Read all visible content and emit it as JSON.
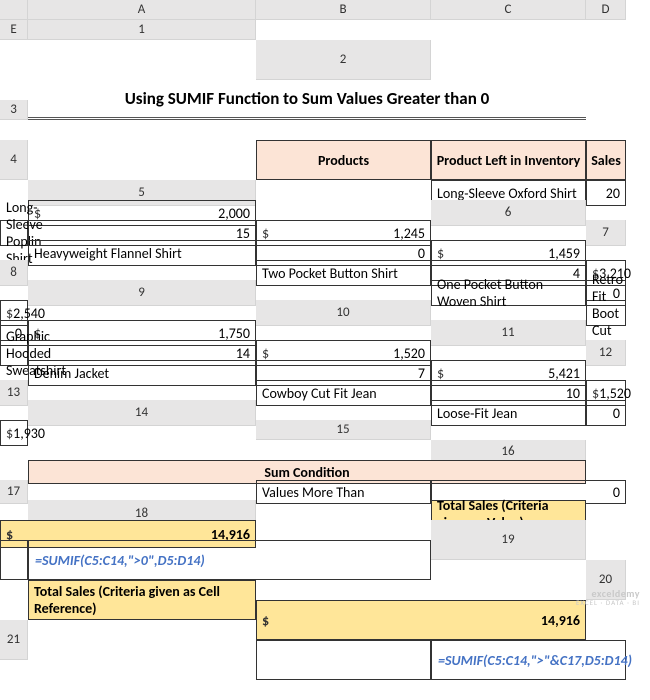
{
  "cols": [
    "",
    "A",
    "B",
    "C",
    "D",
    "E"
  ],
  "title": "Using SUMIF Function to Sum Values Greater than 0",
  "table": {
    "headers": [
      "Products",
      "Product Left in Inventory",
      "Sales"
    ],
    "rows": [
      {
        "p": "Long-Sleeve Oxford Shirt",
        "inv": "20",
        "sales": "2,000"
      },
      {
        "p": "Long-Sleeve Poplin Shirt",
        "inv": "15",
        "sales": "1,245"
      },
      {
        "p": "Heavyweight Flannel Shirt",
        "inv": "0",
        "sales": "1,459"
      },
      {
        "p": "Two Pocket Button Shirt",
        "inv": "4",
        "sales": "3,210"
      },
      {
        "p": "One Pocket Button Woven Shirt",
        "inv": "0",
        "sales": "2,540"
      },
      {
        "p": "Retro Fit Boot Cut Jean",
        "inv": "0",
        "sales": "1,750"
      },
      {
        "p": "Graphic Hooded Sweatshirt",
        "inv": "14",
        "sales": "1,520"
      },
      {
        "p": "Denim Jacket",
        "inv": "7",
        "sales": "5,421"
      },
      {
        "p": "Cowboy Cut Fit Jean",
        "inv": "10",
        "sales": "1,520"
      },
      {
        "p": "Loose-Fit Jean",
        "inv": "0",
        "sales": "1,930"
      }
    ]
  },
  "sum": {
    "header": "Sum Condition",
    "r1_label": "Values More Than",
    "r1_val": "0",
    "r2_label": "Total Sales (Criteria given as Value)",
    "r2_val": "14,916",
    "f1": "=SUMIF(C5:C14,\">0\",D5:D14)",
    "r3_label": "Total Sales (Criteria given as Cell Reference)",
    "r3_val": "14,916",
    "f2": "=SUMIF(C5:C14,\">\"&C17,D5:D14)"
  },
  "cur": "$",
  "wm": {
    "t1": "exceldemy",
    "t2": "EXCEL · DATA · BI"
  }
}
